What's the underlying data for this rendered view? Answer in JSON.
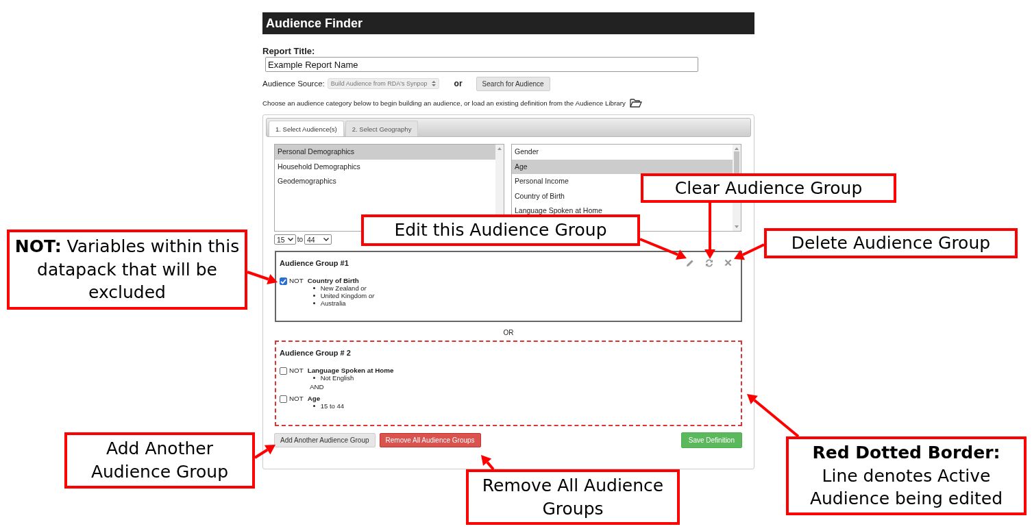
{
  "app": {
    "title": "Audience Finder"
  },
  "report_title": {
    "label": "Report Title:",
    "value": "Example Report Name"
  },
  "audience_source": {
    "label": "Audience Source:",
    "value": "Build Audience from RDA's Synpop",
    "or_label": "or",
    "search_button": "Search for Audience"
  },
  "hint": "Choose an audience category below to begin building an audience, or load an existing definition from the Audience Library",
  "tabs": [
    {
      "label": "1. Select Audience(s)",
      "selected": true
    },
    {
      "label": "2. Select Geography",
      "selected": false
    }
  ],
  "category_list": [
    {
      "label": "Personal Demographics",
      "selected": true
    },
    {
      "label": "Household Demographics",
      "selected": false
    },
    {
      "label": "Geodemographics",
      "selected": false
    }
  ],
  "variable_list": [
    {
      "label": "Gender",
      "selected": false
    },
    {
      "label": "Age",
      "selected": true
    },
    {
      "label": "Personal Income",
      "selected": false
    },
    {
      "label": "Country of Birth",
      "selected": false
    },
    {
      "label": "Language Spoken at Home",
      "selected": false
    }
  ],
  "age_range": {
    "from": "15",
    "to_label": "to",
    "to": "44"
  },
  "groups": [
    {
      "title": "Audience Group #1",
      "active": false,
      "show_actions": true,
      "conditions": [
        {
          "not": true,
          "not_label": "NOT",
          "variable": "Country of Birth",
          "values": [
            "New Zealand *or*",
            "United Kingdom *or*",
            "Australia"
          ]
        }
      ]
    },
    {
      "separator": "OR",
      "title": "Audience Group # 2",
      "active": true,
      "show_actions": false,
      "conditions": [
        {
          "not": false,
          "not_label": "NOT",
          "variable": "Language Spoken at Home",
          "values": [
            "Not English"
          ]
        },
        {
          "joiner": "AND",
          "not": false,
          "not_label": "NOT",
          "variable": "Age",
          "values": [
            "15 to 44"
          ]
        }
      ]
    }
  ],
  "buttons": {
    "add": "Add Another Audience Group",
    "remove": "Remove All Audience Groups",
    "save": "Save Definition"
  },
  "callouts": [
    {
      "text": "Clear Audience Group"
    },
    {
      "text": "Edit this Audience Group"
    },
    {
      "text": "**NOT:** Variables within this datapack that will be excluded"
    },
    {
      "text": "Delete Audience Group"
    },
    {
      "text": "Add Another Audience Group"
    },
    {
      "text": "**Red Dotted Border:** Line denotes Active Audience being edited"
    },
    {
      "text": "Remove All Audience Groups"
    }
  ]
}
